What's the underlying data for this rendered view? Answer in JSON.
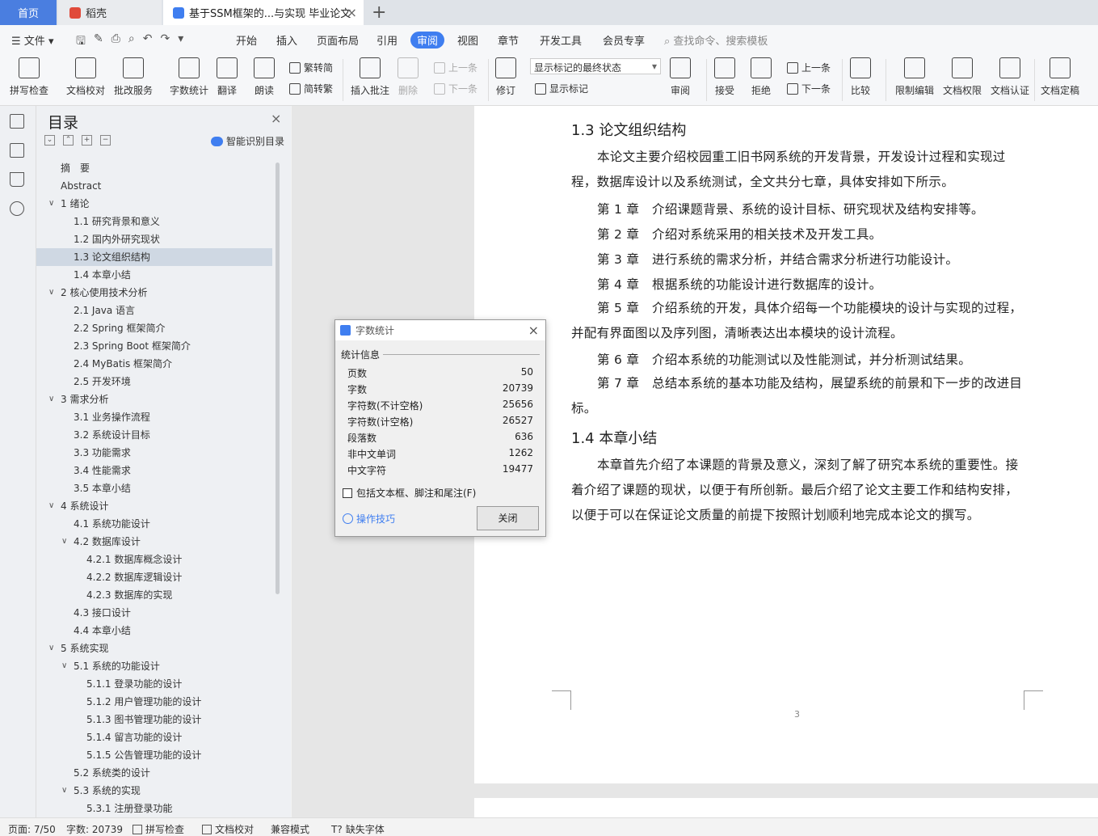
{
  "tabs": {
    "home": "首页",
    "daoke": "稻壳",
    "doc": "基于SSM框架的...与实现 毕业论文"
  },
  "menu": {
    "file": "文件",
    "items": [
      "开始",
      "插入",
      "页面布局",
      "引用",
      "审阅",
      "视图",
      "章节",
      "开发工具",
      "会员专享"
    ],
    "active": "审阅",
    "search": "查找命令、搜索模板"
  },
  "ribbon": {
    "spell": "拼写检查",
    "proof": "文档校对",
    "annot_service": "批改服务",
    "wordcount": "字数统计",
    "translate": "翻译",
    "read": "朗读",
    "to_trad": "繁转简",
    "to_simp": "简转繁",
    "insert_comment": "插入批注",
    "delete": "删除",
    "prev": "上一条",
    "next": "下一条",
    "revise": "修订",
    "mark_state": "显示标记的最终状态",
    "show_marks": "显示标记",
    "review": "审阅",
    "accept": "接受",
    "reject": "拒绝",
    "prev2": "上一条",
    "next2": "下一条",
    "compare": "比较",
    "restrict": "限制编辑",
    "permission": "文档权限",
    "certify": "文档认证",
    "finalize": "文档定稿"
  },
  "toc": {
    "title": "目录",
    "smart": "智能识别目录",
    "items": [
      {
        "text": "摘　要",
        "level": 1,
        "arrow": false
      },
      {
        "text": "Abstract",
        "level": 1,
        "arrow": false
      },
      {
        "text": "1  绪论",
        "level": 1,
        "arrow": true
      },
      {
        "text": "1.1  研究背景和意义",
        "level": 2,
        "arrow": false
      },
      {
        "text": "1.2  国内外研究现状",
        "level": 2,
        "arrow": false
      },
      {
        "text": "1.3  论文组织结构",
        "level": 2,
        "arrow": false,
        "selected": true
      },
      {
        "text": "1.4  本章小结",
        "level": 2,
        "arrow": false
      },
      {
        "text": "2  核心使用技术分析",
        "level": 1,
        "arrow": true
      },
      {
        "text": "2.1 Java 语言",
        "level": 2,
        "arrow": false
      },
      {
        "text": "2.2 Spring 框架简介",
        "level": 2,
        "arrow": false
      },
      {
        "text": "2.3 Spring Boot 框架简介",
        "level": 2,
        "arrow": false
      },
      {
        "text": "2.4 MyBatis  框架简介",
        "level": 2,
        "arrow": false
      },
      {
        "text": "2.5  开发环境",
        "level": 2,
        "arrow": false
      },
      {
        "text": "3  需求分析",
        "level": 1,
        "arrow": true
      },
      {
        "text": "3.1  业务操作流程",
        "level": 2,
        "arrow": false
      },
      {
        "text": "3.2  系统设计目标",
        "level": 2,
        "arrow": false
      },
      {
        "text": "3.3  功能需求",
        "level": 2,
        "arrow": false
      },
      {
        "text": "3.4  性能需求",
        "level": 2,
        "arrow": false
      },
      {
        "text": "3.5  本章小结",
        "level": 2,
        "arrow": false
      },
      {
        "text": "4  系统设计",
        "level": 1,
        "arrow": true
      },
      {
        "text": "4.1  系统功能设计",
        "level": 2,
        "arrow": false
      },
      {
        "text": "4.2  数据库设计",
        "level": 2,
        "arrow": true
      },
      {
        "text": "4.2.1  数据库概念设计",
        "level": 3,
        "arrow": false
      },
      {
        "text": "4.2.2  数据库逻辑设计",
        "level": 3,
        "arrow": false
      },
      {
        "text": "4.2.3  数据库的实现",
        "level": 3,
        "arrow": false
      },
      {
        "text": "4.3  接口设计",
        "level": 2,
        "arrow": false
      },
      {
        "text": "4.4  本章小结",
        "level": 2,
        "arrow": false
      },
      {
        "text": "5  系统实现",
        "level": 1,
        "arrow": true
      },
      {
        "text": "5.1  系统的功能设计",
        "level": 2,
        "arrow": true
      },
      {
        "text": "5.1.1  登录功能的设计",
        "level": 3,
        "arrow": false
      },
      {
        "text": "5.1.2  用户管理功能的设计",
        "level": 3,
        "arrow": false
      },
      {
        "text": "5.1.3  图书管理功能的设计",
        "level": 3,
        "arrow": false
      },
      {
        "text": "5.1.4  留言功能的设计",
        "level": 3,
        "arrow": false
      },
      {
        "text": "5.1.5  公告管理功能的设计",
        "level": 3,
        "arrow": false
      },
      {
        "text": "5.2  系统类的设计",
        "level": 2,
        "arrow": false
      },
      {
        "text": "5.3  系统的实现",
        "level": 2,
        "arrow": true
      },
      {
        "text": "5.3.1  注册登录功能",
        "level": 3,
        "arrow": false
      }
    ]
  },
  "doc": {
    "h13": "1.3  论文组织结构",
    "p1": "本论文主要介绍校园重工旧书网系统的开发背景，开发设计过程和实现过程，数据库设计以及系统测试，全文共分七章，具体安排如下所示。",
    "ch1": "第 1 章　介绍课题背景、系统的设计目标、研究现状及结构安排等。",
    "ch2": "第 2 章　介绍对系统采用的相关技术及开发工具。",
    "ch3": "第 3 章　进行系统的需求分析，并结合需求分析进行功能设计。",
    "ch4": "第 4 章　根据系统的功能设计进行数据库的设计。",
    "ch5": "第 5 章　介绍系统的开发，具体介绍每一个功能模块的设计与实现的过程，并配有界面图以及序列图，清晰表达出本模块的设计流程。",
    "ch6": "第 6 章　介绍本系统的功能测试以及性能测试，并分析测试结果。",
    "ch7": "第 7 章　总结本系统的基本功能及结构，展望系统的前景和下一步的改进目标。",
    "h14": "1.4  本章小结",
    "p2": "本章首先介绍了本课题的背景及意义，深刻了解了研究本系统的重要性。接着介绍了课题的现状，以便于有所创新。最后介绍了论文主要工作和结构安排，以便于可以在保证论文质量的前提下按照计划顺利地完成本论文的撰写。",
    "page_no": "3"
  },
  "dialog": {
    "title": "字数统计",
    "section": "统计信息",
    "rows": [
      {
        "label": "页数",
        "value": "50"
      },
      {
        "label": "字数",
        "value": "20739"
      },
      {
        "label": "字符数(不计空格)",
        "value": "25656"
      },
      {
        "label": "字符数(计空格)",
        "value": "26527"
      },
      {
        "label": "段落数",
        "value": "636"
      },
      {
        "label": "非中文单词",
        "value": "1262"
      },
      {
        "label": "中文字符",
        "value": "19477"
      }
    ],
    "checkbox": "包括文本框、脚注和尾注(F)",
    "tips": "操作技巧",
    "close": "关闭"
  },
  "status": {
    "page": "页面: 7/50",
    "words": "字数: 20739",
    "spell": "拼写检查",
    "proof": "文档校对",
    "compat": "兼容模式",
    "missing_font": "缺失字体"
  }
}
